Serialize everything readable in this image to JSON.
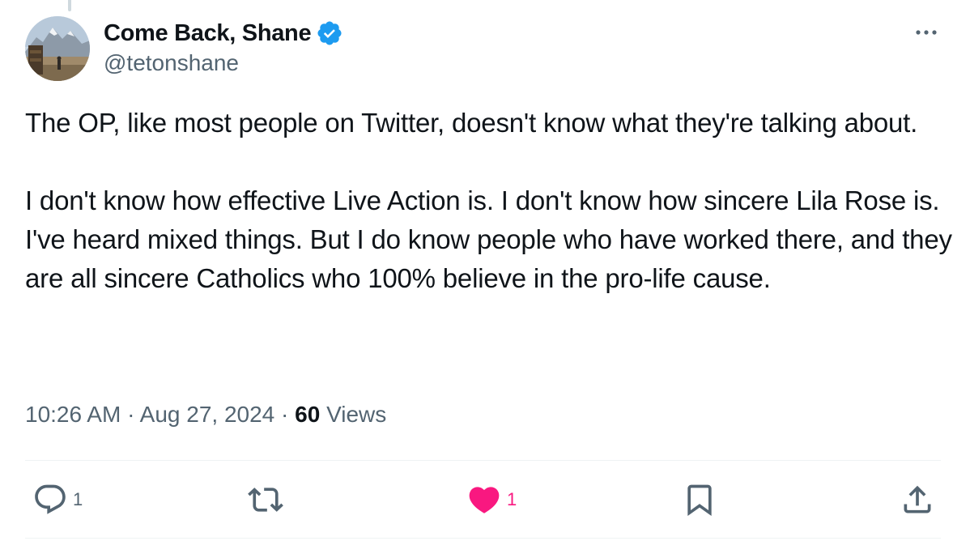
{
  "author": {
    "display_name": "Come Back, Shane",
    "handle": "@tetonshane",
    "verified_badge": "verified-badge-icon",
    "avatar": "mountain-landscape-avatar"
  },
  "tweet": {
    "paragraphs": [
      "The OP, like most people on Twitter, doesn't know what they're talking about.",
      "I don't know how effective Live Action is. I don't know how sincere Lila Rose is. I've heard mixed things. But I do know people who have worked there, and they are all  sincere Catholics who 100% believe in the pro-life cause."
    ]
  },
  "meta": {
    "time": "10:26 AM",
    "separator": "·",
    "date": "Aug 27, 2024",
    "views_count": "60",
    "views_label": "Views"
  },
  "actions": {
    "reply": {
      "icon": "reply-icon",
      "count": "1"
    },
    "retweet": {
      "icon": "retweet-icon",
      "count": ""
    },
    "like": {
      "icon": "heart-icon",
      "count": "1",
      "liked": true
    },
    "bookmark": {
      "icon": "bookmark-icon",
      "count": ""
    },
    "share": {
      "icon": "share-icon",
      "count": ""
    }
  },
  "colors": {
    "text": "#0f1419",
    "secondary": "#536471",
    "verified_blue": "#1d9bf0",
    "like_pink": "#f91880",
    "divider": "#eff3f4"
  },
  "more_menu": {
    "icon": "more-options-icon"
  }
}
